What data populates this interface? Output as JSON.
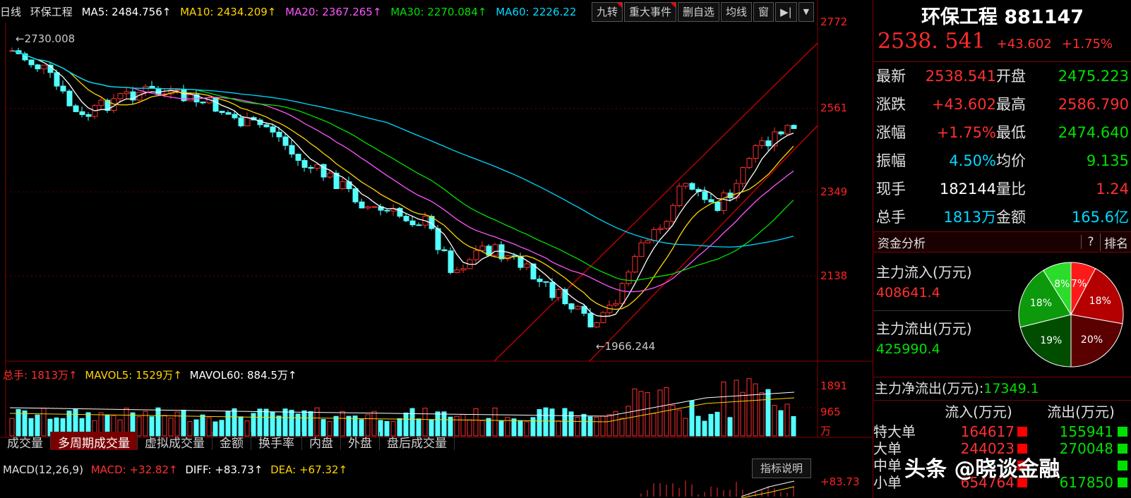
{
  "top": {
    "period": "日线",
    "name": "环保工程",
    "ma5": "MA5: 2484.756↑",
    "ma10": "MA10: 2434.209↑",
    "ma20": "MA20: 2367.265↑",
    "ma30": "MA30: 2270.084↑",
    "ma60": "MA60: 2226.22",
    "buttons": [
      "九转",
      "重大事件",
      "删自选",
      "均线",
      "窗"
    ],
    "colors": {
      "ma5": "#ffffff",
      "ma10": "#ffd400",
      "ma20": "#ff55ff",
      "ma30": "#00e000",
      "ma60": "#00d8ff"
    }
  },
  "price_axis": [
    "2772",
    "2561",
    "2349",
    "2138"
  ],
  "annotations": {
    "high": "2730.008",
    "low": "1966.244"
  },
  "volume_header": {
    "total": "总手: 1813万↑",
    "mavol5": "MAVOL5: 1529万↑",
    "mavol60": "MAVOL60: 884.5万↑"
  },
  "volume_axis": [
    "1891",
    "965",
    "万"
  ],
  "tabs": [
    "成交量",
    "多周期成交量",
    "虚拟成交量",
    "金额",
    "换手率",
    "内盘",
    "外盘",
    "盘后成交量"
  ],
  "macd_header": {
    "name": "MACD(12,26,9)",
    "macd": "MACD: +32.82↑",
    "diff": "DIFF: +83.73↑",
    "dea": "DEA: +67.32↑",
    "button": "指标说明",
    "axis": "+83.73"
  },
  "panel": {
    "title": "环保工程 881147",
    "price": "2538. 541",
    "change": "+43.602",
    "pct": "+1.75%",
    "rows": [
      {
        "l1": "最新",
        "v1": "2538.541",
        "l2": "开盘",
        "v2": "2475.223",
        "c1": "#ff3030",
        "c2": "#00e000"
      },
      {
        "l1": "涨跌",
        "v1": "+43.602",
        "l2": "最高",
        "v2": "2586.790",
        "c1": "#ff3030",
        "c2": "#ff3030"
      },
      {
        "l1": "涨幅",
        "v1": "+1.75%",
        "l2": "最低",
        "v2": "2474.640",
        "c1": "#ff3030",
        "c2": "#00e000"
      },
      {
        "l1": "振幅",
        "v1": "4.50%",
        "l2": "均价",
        "v2": "9.135",
        "c1": "#00d8ff",
        "c2": "#00e000"
      },
      {
        "l1": "现手",
        "v1": "182144",
        "l2": "量比",
        "v2": "1.24",
        "c1": "#ffffff",
        "c2": "#ff3030"
      },
      {
        "l1": "总手",
        "v1": "1813万",
        "l2": "金额",
        "v2": "165.6亿",
        "c1": "#00d8ff",
        "c2": "#00d8ff"
      }
    ],
    "fund_header": "资金分析",
    "fund_q": "?",
    "fund_rank": "排名",
    "inflow_label": "主力流入(万元)",
    "inflow_value": "408641.4",
    "outflow_label": "主力流出(万元)",
    "outflow_value": "425990.4",
    "net_label": "主力净流出(万元):",
    "net_value": "17349.1",
    "pie": [
      {
        "label": "7%",
        "value": 7,
        "color": "#ff1a1a"
      },
      {
        "label": "18%",
        "value": 18,
        "color": "#b40000"
      },
      {
        "label": "20%",
        "value": 20,
        "color": "#5a0000"
      },
      {
        "label": "19%",
        "value": 19,
        "color": "#004d00"
      },
      {
        "label": "18%",
        "value": 18,
        "color": "#0c9a0c"
      },
      {
        "label": "8%",
        "value": 8,
        "color": "#2bdc2b"
      }
    ],
    "flow_headers": [
      "流入(万元)",
      "流出(万元)"
    ],
    "flow_rows": [
      {
        "label": "特大单",
        "in": "164617",
        "out": "155941"
      },
      {
        "label": "大单",
        "in": "244023",
        "out": "270048"
      },
      {
        "label": "中单",
        "in": "",
        "out": ""
      },
      {
        "label": "小单",
        "in": "654764",
        "out": "617850"
      }
    ],
    "watermark": "头条 @晓谈金融"
  }
}
